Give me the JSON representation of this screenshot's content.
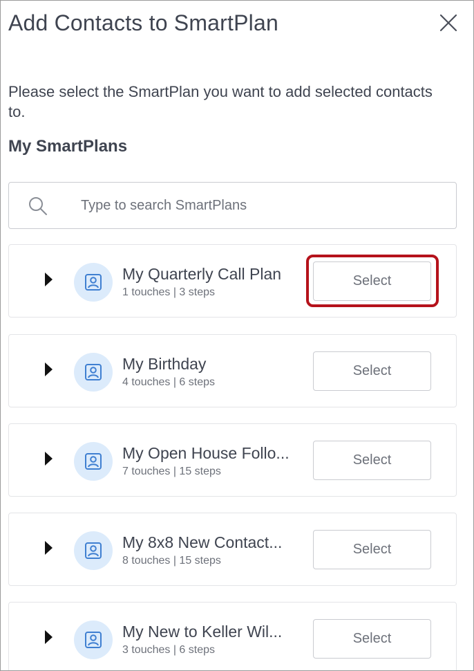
{
  "dialog": {
    "title": "Add Contacts to SmartPlan",
    "prompt": "Please select the SmartPlan you want to add selected contacts to.",
    "section_title": "My SmartPlans",
    "close_icon": "close-icon"
  },
  "search": {
    "placeholder": "Type to search SmartPlans",
    "value": "",
    "icon": "search-icon"
  },
  "plans": [
    {
      "name": "My Quarterly Call Plan",
      "meta": "1 touches | 3 steps",
      "select_label": "Select",
      "highlighted": true
    },
    {
      "name": "My Birthday",
      "meta": "4 touches | 6 steps",
      "select_label": "Select",
      "highlighted": false
    },
    {
      "name": "My Open House Follo...",
      "meta": "7 touches | 15 steps",
      "select_label": "Select",
      "highlighted": false
    },
    {
      "name": "My 8x8 New Contact...",
      "meta": "8 touches | 15 steps",
      "select_label": "Select",
      "highlighted": false
    },
    {
      "name": "My New to Keller Wil...",
      "meta": "3 touches | 6 steps",
      "select_label": "Select",
      "highlighted": false
    }
  ],
  "colors": {
    "highlight": "#b5121b",
    "avatar_bg": "#dcebfb",
    "avatar_icon": "#3f7fd1"
  }
}
